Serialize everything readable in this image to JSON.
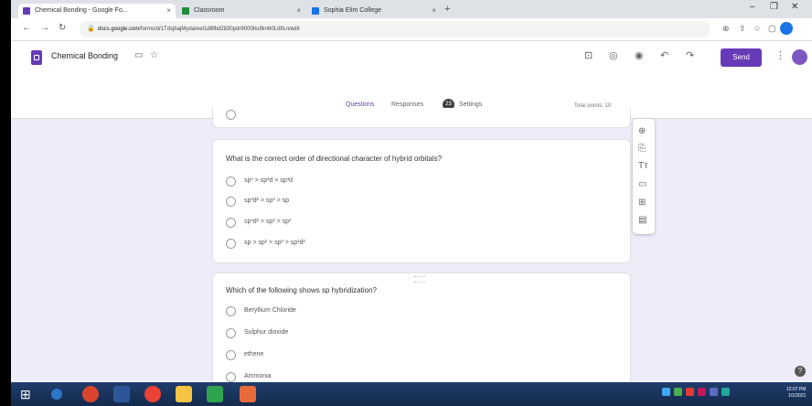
{
  "browser": {
    "tabs": [
      {
        "title": "Chemical Bonding - Google Fo...",
        "active": true
      },
      {
        "title": "Classroom",
        "active": false
      },
      {
        "title": "Sophia Elim College",
        "active": false
      }
    ],
    "close_glyph": "×",
    "new_tab_glyph": "+",
    "window_controls": [
      "–",
      "❐",
      "✕"
    ],
    "url_domain": "docs.google.com",
    "url_path": "/forms/d/1TdsjbajMydareel1d8fbd2830pdr9000hul9n4t0LIi9Ln/edit"
  },
  "header": {
    "form_title": "Chemical Bonding",
    "send_label": "Send",
    "more_glyph": "⋮"
  },
  "tabs": {
    "questions": "Questions",
    "responses": "Responses",
    "responses_count": "23",
    "settings": "Settings",
    "total_points": "Total points: 10"
  },
  "questions": [
    {
      "title": "What is the correct order of directional character of hybrid orbitals?",
      "options": [
        "sp³ > sp³d > sp³d",
        "sp³d² > sp³ > sp",
        "sp³d² > sp² > sp³",
        "sp > sp² > sp³ > sp³d²"
      ]
    },
    {
      "title": "Which of the following shows sp hybridization?",
      "options": [
        "Beryllium Chloride",
        "Sulphur dioxide",
        "ethene",
        "Ammonia"
      ]
    }
  ],
  "colors": {
    "brand": "#673ab7",
    "background": "#f0ebf8",
    "taskbar": "#1f3d6b"
  },
  "icons": {
    "sidebar": [
      "add-question-icon",
      "import-questions-icon",
      "add-title-icon",
      "add-image-icon",
      "add-video-icon",
      "add-section-icon"
    ],
    "toolbar": [
      "palette-icon",
      "preview-icon",
      "undo-icon",
      "redo-icon"
    ]
  },
  "clock": {
    "time": "12:07 PM",
    "date": "1/1/2021"
  }
}
